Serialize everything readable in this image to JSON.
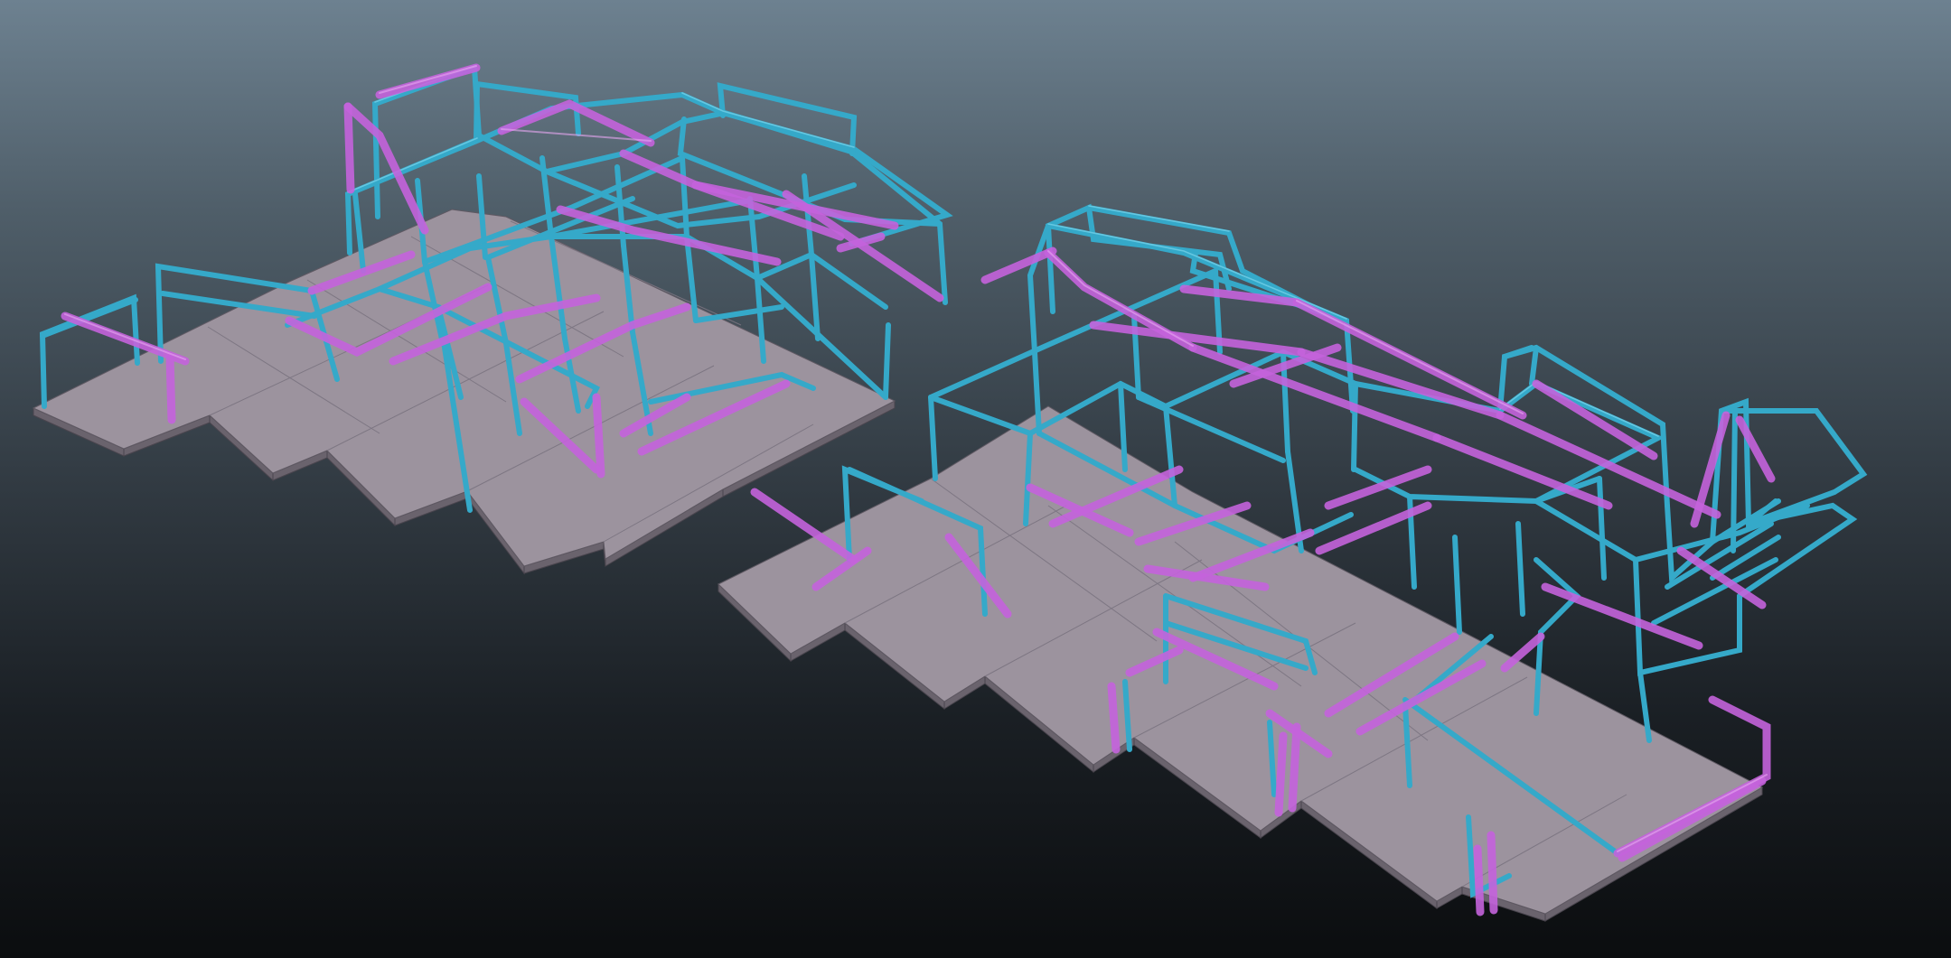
{
  "viewport": {
    "background_top": "#6d8190",
    "background_bottom": "#0b0d0f"
  },
  "scene": {
    "objects": [
      {
        "name": "left-building",
        "frame_color": "#35a9c9",
        "highlight_color": "#c463db",
        "slab_color": "#9c939e"
      },
      {
        "name": "right-building",
        "frame_color": "#35a9c9",
        "highlight_color": "#c463db",
        "slab_color": "#9c939e"
      }
    ]
  }
}
